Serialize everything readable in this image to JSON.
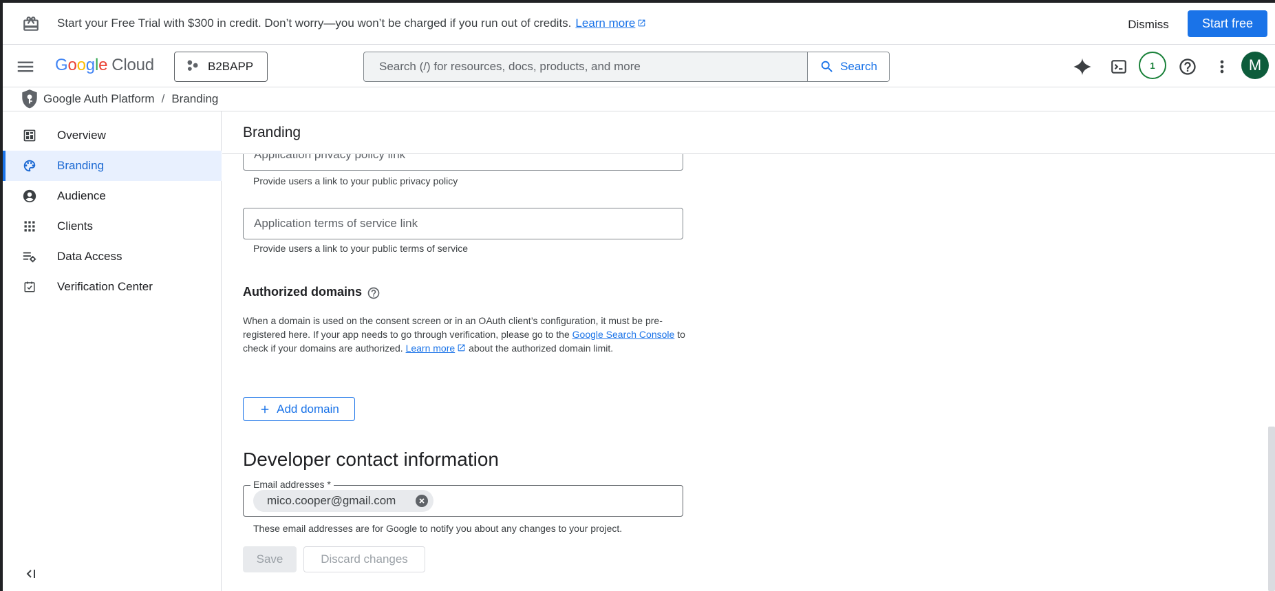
{
  "banner": {
    "text": "Start your Free Trial with $300 in credit. Don’t worry—you won’t be charged if you run out of credits.",
    "learn_more": "Learn more",
    "dismiss_label": "Dismiss",
    "start_free_label": "Start free"
  },
  "header": {
    "logo_g": "G",
    "logo_o1": "o",
    "logo_o2": "o",
    "logo_g2": "g",
    "logo_l": "l",
    "logo_e": "e",
    "logo_product": "Cloud",
    "project_name": "B2BAPP",
    "search_placeholder": "Search (/) for resources, docs, products, and more",
    "search_button": "Search",
    "notification_count": "1",
    "avatar_initial": "M"
  },
  "breadcrumb": {
    "root": "Google Auth Platform",
    "separator": "/",
    "current": "Branding"
  },
  "sidebar": {
    "items": [
      {
        "label": "Overview",
        "icon": "dashboard-icon"
      },
      {
        "label": "Branding",
        "icon": "palette-icon"
      },
      {
        "label": "Audience",
        "icon": "account-circle-icon"
      },
      {
        "label": "Clients",
        "icon": "apps-grid-icon"
      },
      {
        "label": "Data Access",
        "icon": "data-access-icon"
      },
      {
        "label": "Verification Center",
        "icon": "verification-check-icon"
      }
    ],
    "active_index": 1
  },
  "main": {
    "page_title": "Branding",
    "privacy_field": {
      "placeholder": "Application privacy policy link",
      "helper": "Provide users a link to your public privacy policy"
    },
    "tos_field": {
      "placeholder": "Application terms of service link",
      "helper": "Provide users a link to your public terms of service"
    },
    "authorized_domains": {
      "title": "Authorized domains",
      "desc_part1": "When a domain is used on the consent screen or in an OAuth client’s configuration, it must be pre-registered here. If your app needs to go through verification, please go to the",
      "search_console_link": "Google Search Console",
      "desc_part2": "to check if your domains are authorized.",
      "learn_more_link": "Learn more",
      "desc_part3": "about the authorized domain limit.",
      "add_domain_label": "Add domain"
    },
    "developer_contact": {
      "title": "Developer contact information",
      "email_label": "Email addresses *",
      "email_chip": "mico.cooper@gmail.com",
      "helper": "These email addresses are for Google to notify you about any changes to your project."
    },
    "save_label": "Save",
    "discard_label": "Discard changes"
  },
  "colors": {
    "accent": "#1a73e8",
    "active_nav_bg": "#e8f0fe",
    "notification_ring": "#188038",
    "avatar_bg": "#0d5c3b"
  }
}
